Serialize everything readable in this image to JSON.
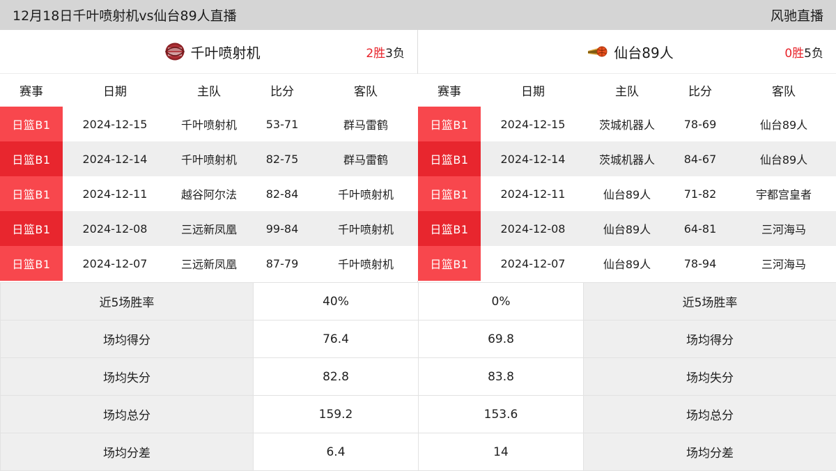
{
  "titlebar": {
    "page_title": "12月18日千叶喷射机vs仙台89人直播",
    "brand": "风驰直播"
  },
  "left_panel": {
    "team": {
      "name": "千叶喷射机",
      "logo_icon": "chiba-jets-logo-icon",
      "logo_color": "#8e2327"
    },
    "record": {
      "wins": "2胜",
      "losses": "3负"
    },
    "table": {
      "headers": [
        "赛事",
        "日期",
        "主队",
        "比分",
        "客队"
      ],
      "rows": [
        {
          "league": "日篮B1",
          "date": "2024-12-15",
          "home": "千叶喷射机",
          "score": "53-71",
          "away": "群马雷鹤"
        },
        {
          "league": "日篮B1",
          "date": "2024-12-14",
          "home": "千叶喷射机",
          "score": "82-75",
          "away": "群马雷鹤"
        },
        {
          "league": "日篮B1",
          "date": "2024-12-11",
          "home": "越谷阿尔法",
          "score": "82-84",
          "away": "千叶喷射机"
        },
        {
          "league": "日篮B1",
          "date": "2024-12-08",
          "home": "三远新凤凰",
          "score": "99-84",
          "away": "千叶喷射机"
        },
        {
          "league": "日篮B1",
          "date": "2024-12-07",
          "home": "三远新凤凰",
          "score": "87-79",
          "away": "千叶喷射机"
        }
      ]
    }
  },
  "right_panel": {
    "team": {
      "name": "仙台89人",
      "logo_icon": "sendai-89ers-logo-icon",
      "logo_color": "#e8a030"
    },
    "record": {
      "wins": "0胜",
      "losses": "5负"
    },
    "table": {
      "headers": [
        "赛事",
        "日期",
        "主队",
        "比分",
        "客队"
      ],
      "rows": [
        {
          "league": "日篮B1",
          "date": "2024-12-15",
          "home": "茨城机器人",
          "score": "78-69",
          "away": "仙台89人"
        },
        {
          "league": "日篮B1",
          "date": "2024-12-14",
          "home": "茨城机器人",
          "score": "84-67",
          "away": "仙台89人"
        },
        {
          "league": "日篮B1",
          "date": "2024-12-11",
          "home": "仙台89人",
          "score": "71-82",
          "away": "宇都宫皇者"
        },
        {
          "league": "日篮B1",
          "date": "2024-12-08",
          "home": "仙台89人",
          "score": "64-81",
          "away": "三河海马"
        },
        {
          "league": "日篮B1",
          "date": "2024-12-07",
          "home": "仙台89人",
          "score": "78-94",
          "away": "三河海马"
        }
      ]
    }
  },
  "stats": [
    {
      "label_left": "近5场胜率",
      "value_left": "40%",
      "value_right": "0%",
      "label_right": "近5场胜率"
    },
    {
      "label_left": "场均得分",
      "value_left": "76.4",
      "value_right": "69.8",
      "label_right": "场均得分"
    },
    {
      "label_left": "场均失分",
      "value_left": "82.8",
      "value_right": "83.8",
      "label_right": "场均失分"
    },
    {
      "label_left": "场均总分",
      "value_left": "159.2",
      "value_right": "153.6",
      "label_right": "场均总分"
    },
    {
      "label_left": "场均分差",
      "value_left": "6.4",
      "value_right": "14",
      "label_right": "场均分差"
    }
  ],
  "colors": {
    "accent_red": "#e8262e",
    "badge_light": "#f8474d",
    "titlebar_bg": "#d5d5d5",
    "row_stripe": "#eeeeee"
  }
}
